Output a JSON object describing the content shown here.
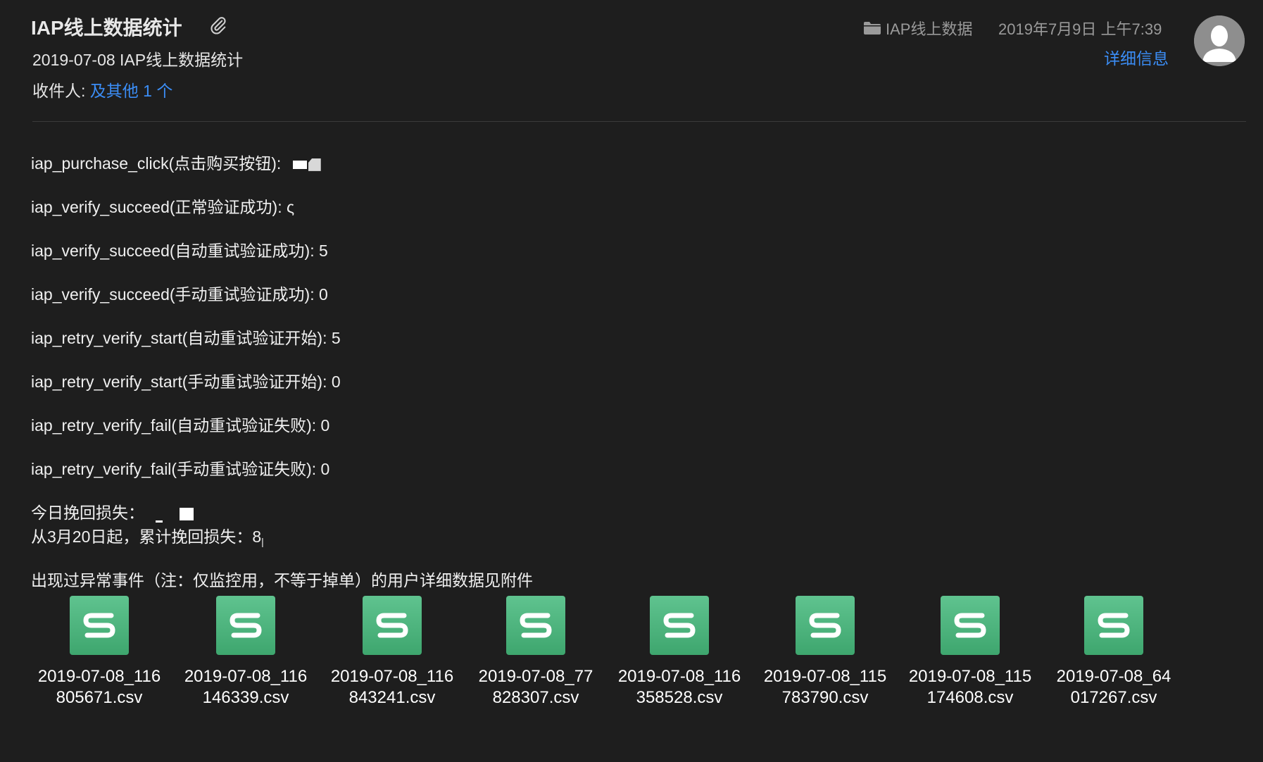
{
  "header": {
    "subject": "IAP线上数据统计",
    "subtitle": "2019-07-08 IAP线上数据统计",
    "recipients_label": "收件人:",
    "recipients_link": "及其他 1 个",
    "folder": "IAP线上数据",
    "date": "2019年7月9日 上午7:39",
    "details_link": "详细信息"
  },
  "body": {
    "lines": [
      "iap_purchase_click(点击购买按钮):",
      "iap_verify_succeed(正常验证成功): ",
      "iap_verify_succeed(自动重试验证成功): 5",
      "iap_verify_succeed(手动重试验证成功): 0",
      "iap_retry_verify_start(自动重试验证开始): 5",
      "iap_retry_verify_start(手动重试验证开始): 0",
      "iap_retry_verify_fail(自动重试验证失败): 0",
      "iap_retry_verify_fail(手动重试验证失败): 0"
    ],
    "visible_fragment_1": "ς",
    "recovered_today": "今日挽回损失：",
    "recovered_total": "从3月20日起，累计挽回损失：8",
    "note": "出现过异常事件（注：仅监控用，不等于掉单）的用户详细数据见附件"
  },
  "attachments": [
    {
      "line1": "2019-07-08_116",
      "line2": "805671.csv"
    },
    {
      "line1": "2019-07-08_116",
      "line2": "146339.csv"
    },
    {
      "line1": "2019-07-08_116",
      "line2": "843241.csv"
    },
    {
      "line1": "2019-07-08_77",
      "line2": "828307.csv"
    },
    {
      "line1": "2019-07-08_116",
      "line2": "358528.csv"
    },
    {
      "line1": "2019-07-08_115",
      "line2": "783790.csv"
    },
    {
      "line1": "2019-07-08_115",
      "line2": "174608.csv"
    },
    {
      "line1": "2019-07-08_64",
      "line2": "017267.csv"
    }
  ],
  "icons": {
    "attachment": "paperclip-icon",
    "folder": "folder-icon",
    "avatar": "avatar-silhouette",
    "file": "csv-spreadsheet-icon"
  },
  "colors": {
    "background": "#1e1e1e",
    "link": "#3b8df5",
    "csv_icon": "#4db57e"
  }
}
